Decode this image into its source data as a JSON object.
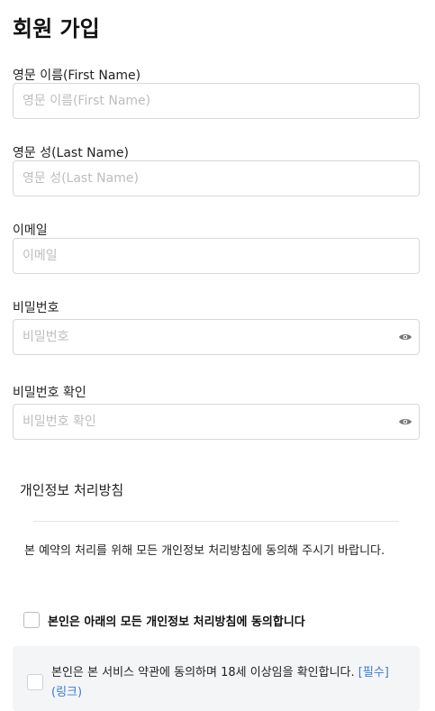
{
  "page": {
    "title": "회원 가입"
  },
  "fields": {
    "first_name": {
      "label": "영문 이름(First Name)",
      "placeholder": "영문 이름(First Name)",
      "value": ""
    },
    "last_name": {
      "label": "영문 성(Last Name)",
      "placeholder": "영문 성(Last Name)",
      "value": ""
    },
    "email": {
      "label": "이메일",
      "placeholder": "이메일",
      "value": ""
    },
    "password": {
      "label": "비밀번호",
      "placeholder": "비밀번호",
      "value": "",
      "icon": "eye-icon"
    },
    "password_confirm": {
      "label": "비밀번호 확인",
      "placeholder": "비밀번호 확인",
      "value": "",
      "icon": "eye-icon"
    }
  },
  "privacy": {
    "title": "개인정보 처리방침",
    "notice": "본 예약의 처리를 위해 모든 개인정보 처리방침에 동의해 주시기 바랍니다.",
    "agree_all_label": "본인은 아래의 모든 개인정보 처리방침에 동의합니다",
    "agree_all_checked": false,
    "terms": {
      "text": "본인은 본 서비스 약관에 동의하며 18세 이상임을 확인합니다.",
      "required_label": "[필수]",
      "link_label": "(링크)",
      "checked": false
    }
  },
  "colors": {
    "link": "#3a7bd5",
    "border": "#d7d7d7",
    "terms_bg": "#f4f5f7"
  }
}
